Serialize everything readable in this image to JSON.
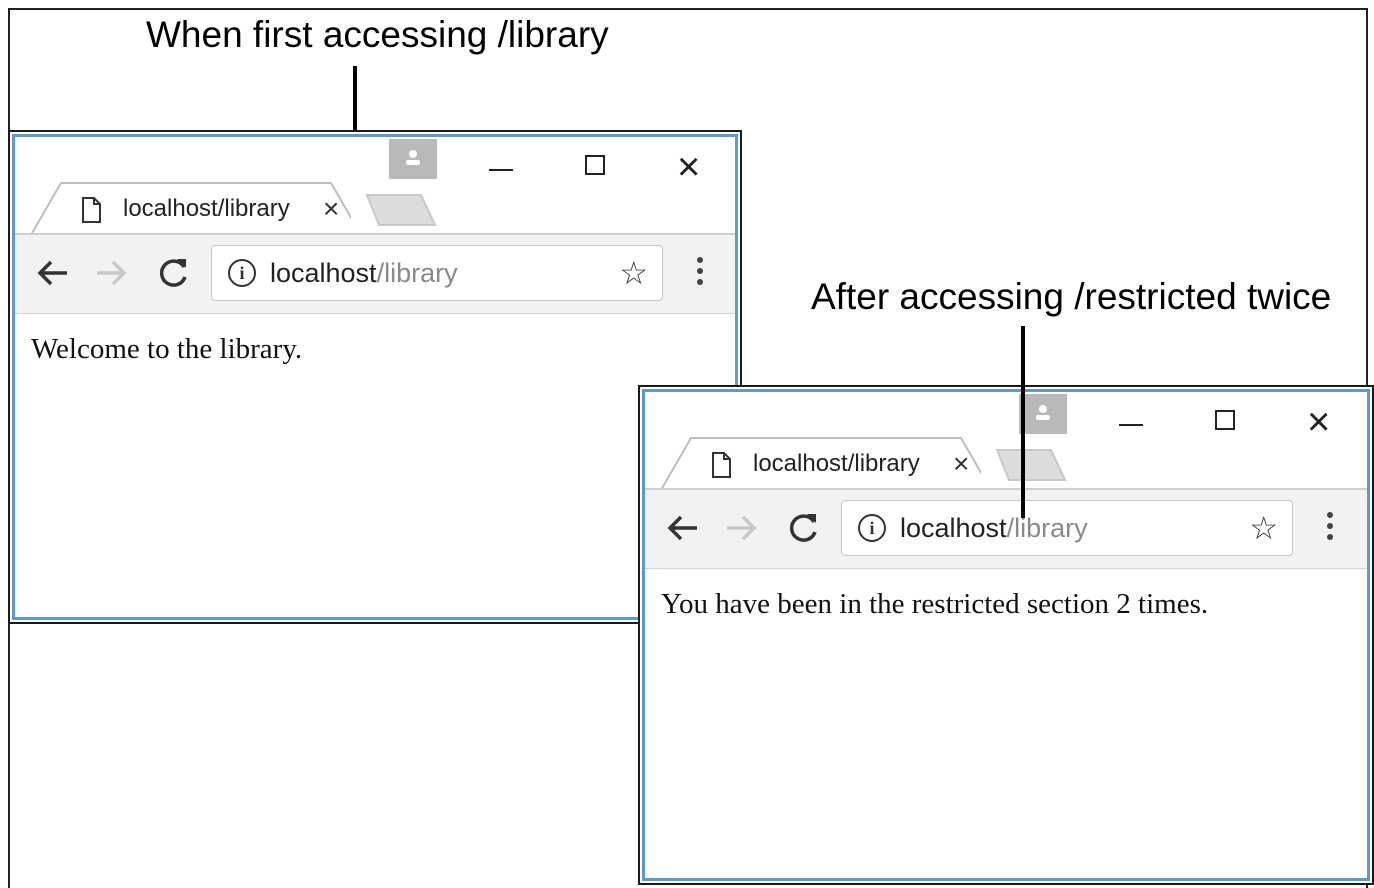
{
  "captions": {
    "first": "When first accessing /library",
    "second": "After accessing /restricted twice"
  },
  "window1": {
    "tab_title": "localhost/library",
    "tab_close": "×",
    "url_host": "localhost",
    "url_path": "/library",
    "page_text": "Welcome to the library."
  },
  "window2": {
    "tab_title": "localhost/library",
    "tab_close": "×",
    "url_host": "localhost",
    "url_path": "/library",
    "page_text": "You have been in the restricted section 2 times."
  },
  "icons": {
    "info": "i",
    "star": "☆",
    "close": "×"
  },
  "colors": {
    "window_accent": "#5b9bd5",
    "url_path": "#8a8a8a"
  }
}
